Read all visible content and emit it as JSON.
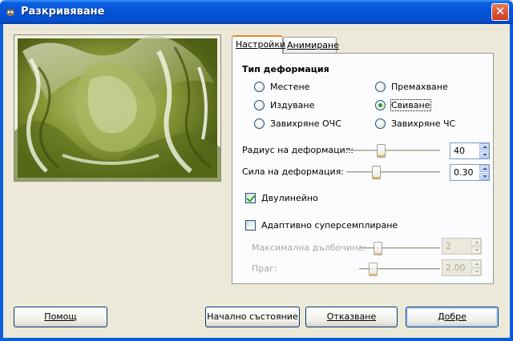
{
  "window": {
    "title": "Разкривяване"
  },
  "tabs": [
    {
      "label": "Настройки",
      "active": true
    },
    {
      "label": "Анимиране",
      "active": false
    }
  ],
  "deformation": {
    "title": "Тип деформация",
    "options": [
      {
        "label": "Местене",
        "checked": false
      },
      {
        "label": "Премахване",
        "checked": false
      },
      {
        "label": "Издуване",
        "checked": false
      },
      {
        "label": "Свиване",
        "checked": true
      },
      {
        "label": "Завихряне ОЧС",
        "checked": false
      },
      {
        "label": "Завихряне ЧС",
        "checked": false
      }
    ]
  },
  "radius": {
    "label": "Радиус на деформация:",
    "value": "40",
    "slider_fraction": 0.36
  },
  "strength": {
    "label": "Сила на деформация:",
    "value": "0.30",
    "slider_fraction": 0.3
  },
  "bilinear": {
    "label": "Двулинейно",
    "checked": true
  },
  "adaptive": {
    "label": "Адаптивно суперсемплиране",
    "checked": false
  },
  "max_depth": {
    "label": "Максимална дълбочина:",
    "value": "2",
    "slider_fraction": 0.2,
    "enabled": false
  },
  "threshold": {
    "label": "Праг:",
    "value": "2.00",
    "slider_fraction": 0.13,
    "enabled": false
  },
  "buttons": {
    "help": "Помощ",
    "reset": "Начално състояние",
    "cancel": "Отказване",
    "ok": "Добре"
  },
  "colors": {
    "accent_green": "#21a121",
    "title_blue": "#0552d6",
    "preview_green": "#8a9c3a"
  },
  "icons": {
    "title": "gimp-icon",
    "close": "close-icon"
  }
}
